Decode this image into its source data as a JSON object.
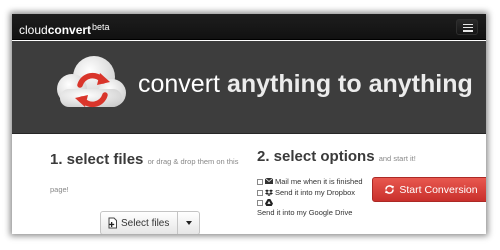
{
  "navbar": {
    "brand_light": "cloud",
    "brand_bold": "convert",
    "brand_sup": "beta",
    "menu_icon": "hamburger-menu-icon"
  },
  "hero": {
    "headline_plain": "convert ",
    "headline_bold": "anything to anything",
    "logo_icon": "cloud-refresh-icon"
  },
  "step1": {
    "title": "1. select files",
    "hint": "or drag & drop them on this page!",
    "select_button_label": "Select files",
    "select_button_icon": "file-add-icon",
    "dropdown_icon": "caret-down-icon"
  },
  "step2": {
    "title": "2. select options",
    "hint": "and start it!",
    "options": [
      {
        "label": "Mail me when it is finished",
        "icon": "envelope-icon",
        "checked": false
      },
      {
        "label": "Send it into my Dropbox",
        "icon": "dropbox-icon",
        "checked": false
      },
      {
        "label": "Send it into my Google Drive",
        "icon": "google-drive-icon",
        "checked": false
      }
    ],
    "start_button_label": "Start Conversion",
    "start_button_icon": "refresh-icon"
  },
  "colors": {
    "navbar": "#151515",
    "hero": "#3d3d3d",
    "start_button": "#d9534f",
    "logo_arrows": "#d9352b"
  }
}
